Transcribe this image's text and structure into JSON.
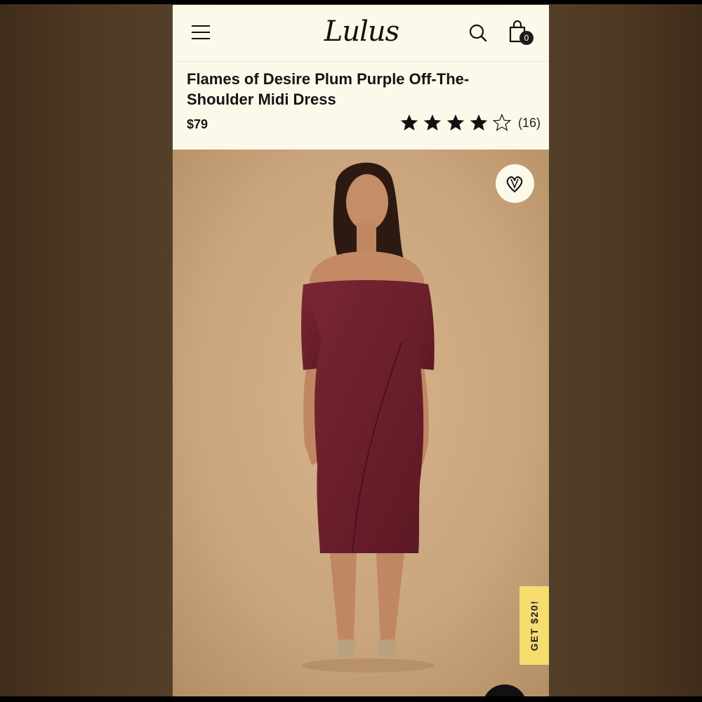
{
  "app": {
    "logo_text": "Lulus",
    "bag_count": "0"
  },
  "product": {
    "title": "Flames of Desire Plum Purple Off-The-Shoulder Midi Dress",
    "price": "$79",
    "rating": 4,
    "rating_max": 5,
    "review_count": "(16)"
  },
  "promo": {
    "label": "GET $20!"
  },
  "icons": [
    "hamburger-menu-icon",
    "search-icon",
    "shopping-bag-icon",
    "star-icon",
    "heart-icon"
  ],
  "colors": {
    "header_background": "#fdf9ea",
    "dress_color": "#6e1f2b",
    "photo_background": "#c9a47c",
    "promo_background": "#f7dc6f"
  }
}
